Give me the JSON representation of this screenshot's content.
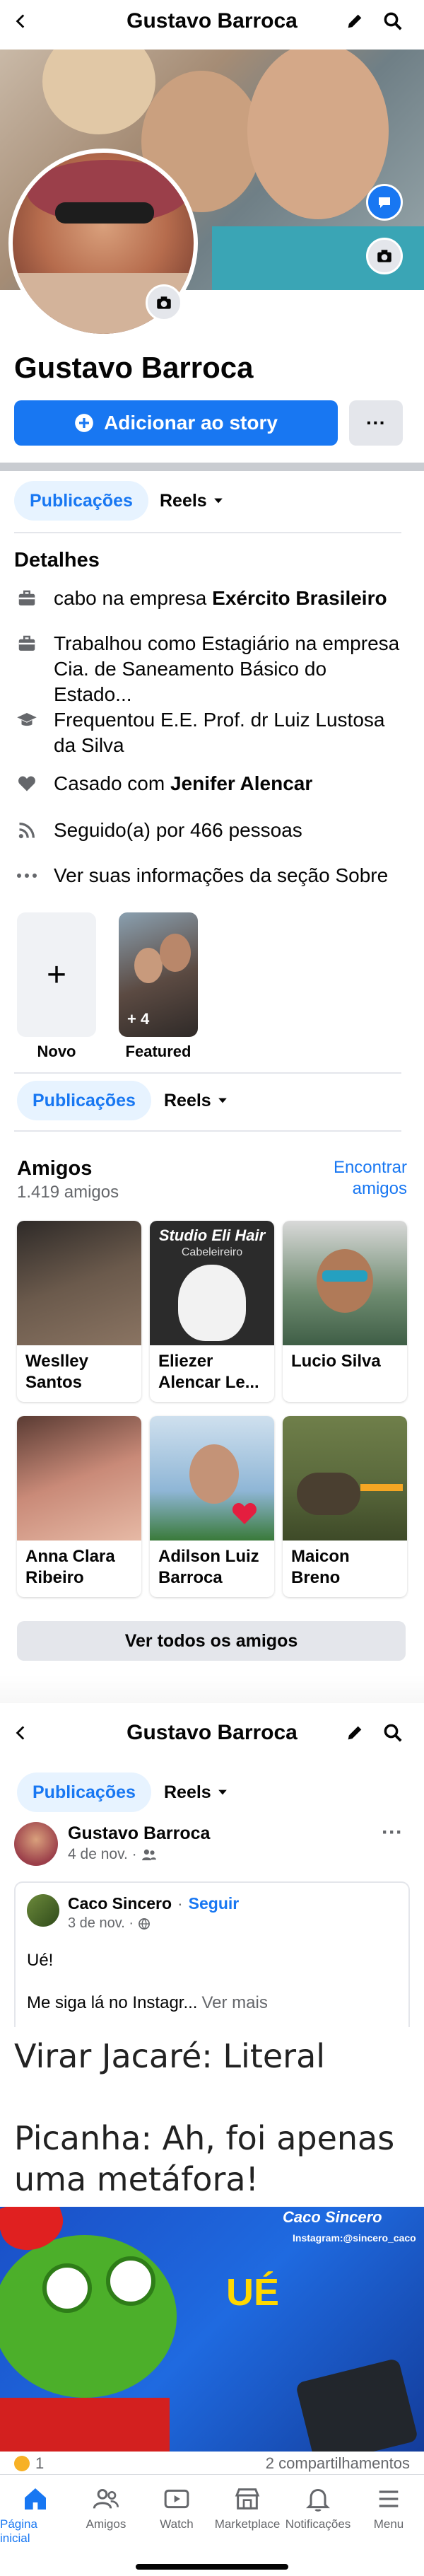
{
  "header": {
    "title": "Gustavo Barroca"
  },
  "profile": {
    "name": "Gustavo Barroca",
    "story_button": "Adicionar ao story",
    "more_button": "···"
  },
  "tabs": {
    "posts": "Publicações",
    "reels": "Reels"
  },
  "details": {
    "title": "Detalhes",
    "items": [
      {
        "icon": "briefcase-icon",
        "text": "cabo na empresa ",
        "bold": "Exército Brasileiro"
      },
      {
        "icon": "briefcase-icon",
        "text": "Trabalhou como Estagiário na empresa Cia. de Saneamento Básico do Estado...",
        "bold": ""
      },
      {
        "icon": "graduation-cap-icon",
        "text": "Frequentou E.E. Prof. dr Luiz Lustosa da Silva",
        "bold": ""
      },
      {
        "icon": "heart-icon",
        "text": "Casado com ",
        "bold": "Jenifer Alencar"
      },
      {
        "icon": "rss-icon",
        "text": "Seguido(a) por 466 pessoas",
        "bold": ""
      },
      {
        "icon": "ellipsis-icon",
        "text": "Ver suas informações da seção Sobre",
        "bold": ""
      }
    ]
  },
  "highlights": {
    "new_label": "Novo",
    "new_symbol": "+",
    "featured_label": "Featured",
    "featured_count": "+ 4"
  },
  "friends": {
    "title": "Amigos",
    "count": "1.419 amigos",
    "find_link": "Encontrar amigos",
    "see_all": "Ver todos os amigos",
    "list": [
      {
        "name": "Weslley Santos",
        "color": "#6b5a4c"
      },
      {
        "name": "Eliezer Alencar Le...",
        "color": "#3a3a3a",
        "caption": "Studio Eli Hair",
        "subcaption": "Cabeleireiro"
      },
      {
        "name": "Lucio Silva",
        "color": "#4e7a5a"
      },
      {
        "name": "Anna Clara Ribeiro",
        "color": "#c98a78"
      },
      {
        "name": "Adilson Luiz Barroca",
        "color": "#8fb6d6"
      },
      {
        "name": "Maicon Breno",
        "color": "#5c6b3d"
      }
    ]
  },
  "post": {
    "author": "Gustavo Barroca",
    "date": "4 de nov. ·",
    "shared_author": "Caco Sincero",
    "follow": "Seguir",
    "shared_date": "3 de nov. ·",
    "text1": "Ué!",
    "text2": "Me siga lá no Instagr...",
    "see_more": "Ver mais",
    "meme_line1": "Virar Jacaré: Literal",
    "meme_line2": "Picanha: Ah, foi apenas uma metáfora!",
    "meme_brand": "Caco Sincero",
    "meme_handle": "Instagram:@sincero_caco",
    "meme_word": "UÉ",
    "reactions": "1",
    "shares": "2 compartilhamentos"
  },
  "bottom_nav": [
    {
      "label": "Página inicial",
      "icon": "home-icon",
      "active": true
    },
    {
      "label": "Amigos",
      "icon": "friends-icon",
      "active": false
    },
    {
      "label": "Watch",
      "icon": "watch-icon",
      "active": false
    },
    {
      "label": "Marketplace",
      "icon": "marketplace-icon",
      "active": false
    },
    {
      "label": "Notificações",
      "icon": "bell-icon",
      "active": false
    },
    {
      "label": "Menu",
      "icon": "menu-icon",
      "active": false
    }
  ],
  "colors": {
    "accent": "#1877f2",
    "chip_bg": "#e7f3ff",
    "button_gray": "#e4e6eb"
  }
}
